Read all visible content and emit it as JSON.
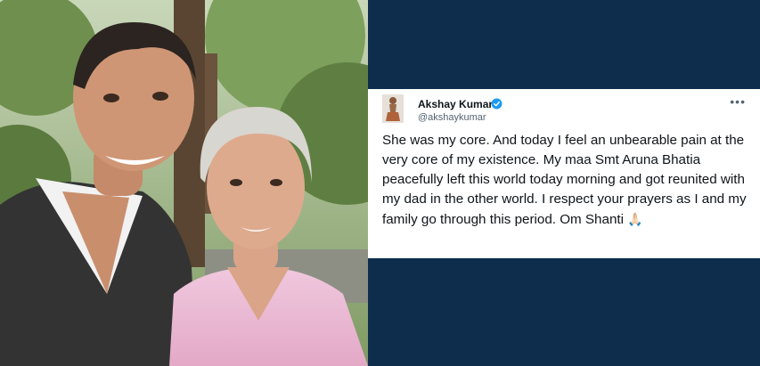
{
  "tweet": {
    "author_name": "Akshay Kumar",
    "author_handle": "@akshaykumar",
    "more_icon": "more-options-icon",
    "text": "She was my core. And today I feel an unbearable pain at the very core of my existence. My maa Smt Aruna Bhatia peacefully left this world today morning and got reunited with my dad in the other world. I respect your prayers as I and my family go through this period. Om Shanti",
    "emoji": "🙏🏻",
    "verified_badge_icon": "verified-badge-icon"
  },
  "colors": {
    "background": "#0e2d4d",
    "verified_blue": "#1d9bf0",
    "text_primary": "#0f1419",
    "text_secondary": "#536471"
  }
}
